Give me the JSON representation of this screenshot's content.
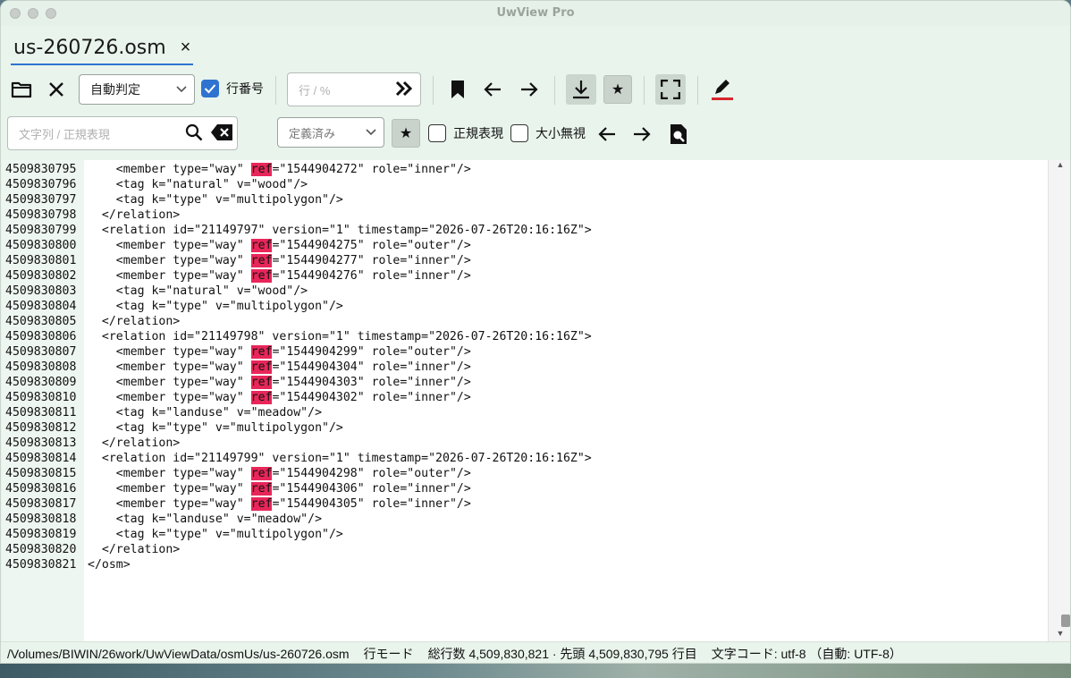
{
  "app": {
    "title": "UwView Pro"
  },
  "tab": {
    "label": "us-260726.osm",
    "close_glyph": "×"
  },
  "toolbar1": {
    "mode_select": "自動判定",
    "line_numbers_label": "行番号",
    "line_numbers_checked": true,
    "goto_placeholder": "行 / %",
    "icons": [
      "folder-icon",
      "close-icon",
      "jump-icon",
      "bookmark-icon",
      "arrow-left-icon",
      "arrow-right-icon",
      "download-icon",
      "star-icon",
      "fullscreen-icon",
      "pen-icon"
    ]
  },
  "toolbar2": {
    "search_placeholder": "文字列 / 正規表現",
    "preset_select": "定義済み",
    "star_glyph": "★",
    "regex_label": "正規表現",
    "ignore_case_label": "大小無視"
  },
  "editor": {
    "highlight_term": "ref",
    "lines": [
      {
        "n": "4509830795",
        "t": "    <member type=\"way\" ",
        "h": "ref",
        "r": "=\"1544904272\" role=\"inner\"/>"
      },
      {
        "n": "4509830796",
        "t": "    <tag k=\"natural\" v=\"wood\"/>"
      },
      {
        "n": "4509830797",
        "t": "    <tag k=\"type\" v=\"multipolygon\"/>"
      },
      {
        "n": "4509830798",
        "t": "  </relation>"
      },
      {
        "n": "4509830799",
        "t": "  <relation id=\"21149797\" version=\"1\" timestamp=\"2026-07-26T20:16:16Z\">"
      },
      {
        "n": "4509830800",
        "t": "    <member type=\"way\" ",
        "h": "ref",
        "r": "=\"1544904275\" role=\"outer\"/>"
      },
      {
        "n": "4509830801",
        "t": "    <member type=\"way\" ",
        "h": "ref",
        "r": "=\"1544904277\" role=\"inner\"/>"
      },
      {
        "n": "4509830802",
        "t": "    <member type=\"way\" ",
        "h": "ref",
        "r": "=\"1544904276\" role=\"inner\"/>"
      },
      {
        "n": "4509830803",
        "t": "    <tag k=\"natural\" v=\"wood\"/>"
      },
      {
        "n": "4509830804",
        "t": "    <tag k=\"type\" v=\"multipolygon\"/>"
      },
      {
        "n": "4509830805",
        "t": "  </relation>"
      },
      {
        "n": "4509830806",
        "t": "  <relation id=\"21149798\" version=\"1\" timestamp=\"2026-07-26T20:16:16Z\">"
      },
      {
        "n": "4509830807",
        "t": "    <member type=\"way\" ",
        "h": "ref",
        "r": "=\"1544904299\" role=\"outer\"/>"
      },
      {
        "n": "4509830808",
        "t": "    <member type=\"way\" ",
        "h": "ref",
        "r": "=\"1544904304\" role=\"inner\"/>"
      },
      {
        "n": "4509830809",
        "t": "    <member type=\"way\" ",
        "h": "ref",
        "r": "=\"1544904303\" role=\"inner\"/>"
      },
      {
        "n": "4509830810",
        "t": "    <member type=\"way\" ",
        "h": "ref",
        "r": "=\"1544904302\" role=\"inner\"/>"
      },
      {
        "n": "4509830811",
        "t": "    <tag k=\"landuse\" v=\"meadow\"/>"
      },
      {
        "n": "4509830812",
        "t": "    <tag k=\"type\" v=\"multipolygon\"/>"
      },
      {
        "n": "4509830813",
        "t": "  </relation>"
      },
      {
        "n": "4509830814",
        "t": "  <relation id=\"21149799\" version=\"1\" timestamp=\"2026-07-26T20:16:16Z\">"
      },
      {
        "n": "4509830815",
        "t": "    <member type=\"way\" ",
        "h": "ref",
        "r": "=\"1544904298\" role=\"outer\"/>"
      },
      {
        "n": "4509830816",
        "t": "    <member type=\"way\" ",
        "h": "ref",
        "r": "=\"1544904306\" role=\"inner\"/>"
      },
      {
        "n": "4509830817",
        "t": "    <member type=\"way\" ",
        "h": "ref",
        "r": "=\"1544904305\" role=\"inner\"/>"
      },
      {
        "n": "4509830818",
        "t": "    <tag k=\"landuse\" v=\"meadow\"/>"
      },
      {
        "n": "4509830819",
        "t": "    <tag k=\"type\" v=\"multipolygon\"/>"
      },
      {
        "n": "4509830820",
        "t": "  </relation>"
      },
      {
        "n": "4509830821",
        "t": "</osm>"
      }
    ]
  },
  "status": {
    "path": "/Volumes/BIWIN/26work/UwViewData/osmUs/us-260726.osm",
    "mode": "行モード",
    "counts": "総行数 4,509,830,821 · 先頭 4,509,830,795 行目",
    "encoding": "文字コード: utf-8 （自動: UTF-8）"
  },
  "colors": {
    "accent": "#2f73d1",
    "highlight": "#e8265a",
    "pen_underline": "#d8262b"
  }
}
